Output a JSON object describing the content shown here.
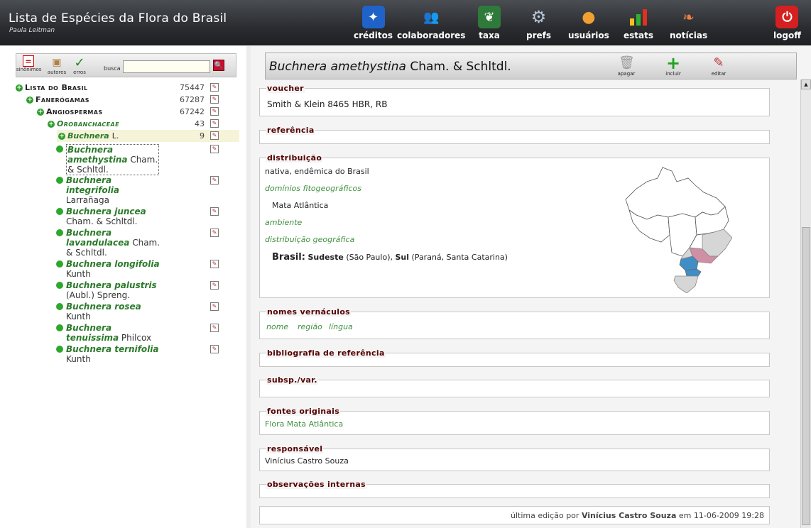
{
  "header": {
    "title": "Lista de Espécies da Flora do Brasil",
    "user": "Paula Leitman",
    "nav": [
      {
        "label": "créditos",
        "icon": "credits-icon"
      },
      {
        "label": "colaboradores",
        "icon": "collaborators-icon"
      },
      {
        "label": "taxa",
        "icon": "taxa-leaf-icon"
      },
      {
        "label": "prefs",
        "icon": "gear-icon"
      },
      {
        "label": "usuários",
        "icon": "user-icon"
      },
      {
        "label": "estats",
        "icon": "stats-icon"
      },
      {
        "label": "notícias",
        "icon": "news-icon"
      },
      {
        "label": "logoff",
        "icon": "power-icon"
      }
    ]
  },
  "toolbar": {
    "synonyms_label": "sinônimos",
    "authors_label": "autores",
    "errors_label": "erros",
    "search_label": "busca",
    "search_value": ""
  },
  "tree": {
    "root": {
      "label": "Lista do Brasil",
      "count": "75447"
    },
    "faner": {
      "label": "Fanerógamas",
      "count": "67287"
    },
    "angio": {
      "label": "Angiospermas",
      "count": "67242"
    },
    "family": {
      "label": "Orobanchaceae",
      "count": "43"
    },
    "genus": {
      "label": "Buchnera",
      "author": "L.",
      "count": "9"
    },
    "species": [
      {
        "name_l1": "Buchnera",
        "name_l2": "amethystina",
        "author_l2": "Cham.",
        "author_l3": "& Schltdl."
      },
      {
        "name_l1": "Buchnera",
        "name_l2": "integrifolia",
        "author_l3": "Larrañaga"
      },
      {
        "name": "Buchnera juncea",
        "author": "Cham. & Schltdl."
      },
      {
        "name_l1": "Buchnera",
        "name_l2": "lavandulacea",
        "author_l2": "Cham.",
        "author_l3": "& Schltdl."
      },
      {
        "name": "Buchnera longifolia",
        "author": "Kunth"
      },
      {
        "name": "Buchnera palustris",
        "author": "(Aubl.) Spreng."
      },
      {
        "name": "Buchnera rosea",
        "author": "Kunth"
      },
      {
        "name_l1": "Buchnera",
        "name_l2": "tenuissima",
        "author_l2": "Philcox"
      },
      {
        "name": "Buchnera ternifolia",
        "author": "Kunth"
      }
    ]
  },
  "detail": {
    "taxon_name": "Buchnera amethystina",
    "taxon_author": "Cham. & Schltdl.",
    "actions": {
      "delete": "apagar",
      "add": "incluir",
      "edit": "editar"
    },
    "voucher_label": "voucher",
    "voucher_value": "Smith & Klein 8465 HBR, RB",
    "referencia_label": "referência",
    "distribuicao_label": "distribuição",
    "distribuicao_status": "nativa, endêmica do Brasil",
    "dominios_label": "domínios fitogeográficos",
    "dominios_value": "Mata Atlântica",
    "ambiente_label": "ambiente",
    "distgeo_label": "distribuição geográfica",
    "brasil_label": "Brasil:",
    "sudeste_label": "Sudeste",
    "sudeste_states": "(São Paulo),",
    "sul_label": "Sul",
    "sul_states": "(Paraná, Santa Catarina)",
    "vernaculos_label": "nomes vernáculos",
    "vernaculos_cols": [
      "nome",
      "região",
      "língua"
    ],
    "bibliografia_label": "bibliografia de referência",
    "subsp_label": "subsp./var.",
    "fontes_label": "fontes originais",
    "fontes_value": "Flora Mata Atlântica",
    "responsavel_label": "responsável",
    "responsavel_value": "Vinícius Castro Souza",
    "observacoes_label": "observações internas",
    "footer_prefix": "última edição por",
    "footer_user": "Vinícius Castro Souza",
    "footer_suffix": "em 11-06-2009 19:28"
  },
  "colors": {
    "accent_green": "#2a7a2a",
    "section_label": "#550000",
    "map_sudeste": "#cf8fa4",
    "map_sul": "#3f8fc6",
    "map_region_grey": "#d6d6d6"
  }
}
